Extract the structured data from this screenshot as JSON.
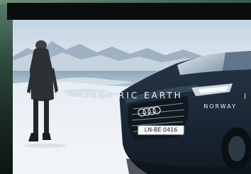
{
  "caption": {
    "title": "ELECTRIC EARTH",
    "location": "NORWAY"
  },
  "car": {
    "plate": "LN-BE 0416"
  },
  "colors": {
    "accent": "#f6e14d",
    "sky": "#c9d8e6",
    "snow": "#eef2f6",
    "car_body": "#1a2633"
  }
}
